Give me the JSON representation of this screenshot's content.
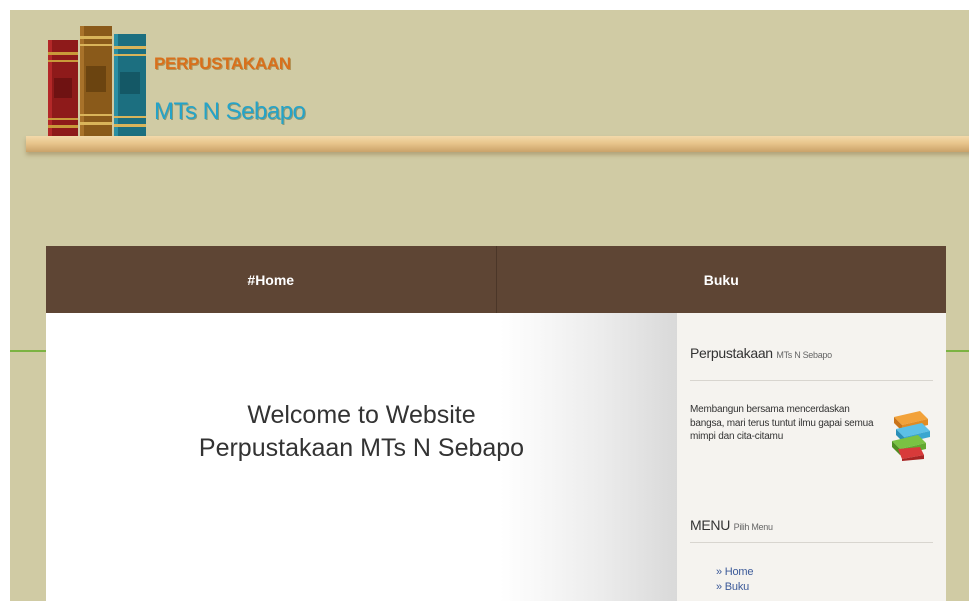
{
  "header": {
    "title": "PERPUSTAKAAN",
    "subtitle": "MTs N Sebapo",
    "logo_icon": "books-icon"
  },
  "nav": {
    "items": [
      {
        "label": "#Home"
      },
      {
        "label": "Buku"
      }
    ]
  },
  "main": {
    "welcome_line1": "Welcome to Website",
    "welcome_line2": "Perpustakaan MTs N Sebapo"
  },
  "sidebar": {
    "widget1": {
      "title": "Perpustakaan",
      "subtitle": "MTs N Sebapo",
      "text": "Membangun bersama mencerdaskan bangsa, mari terus tuntut ilmu gapai semua mimpi dan cita-citamu",
      "icon": "books-stack-icon"
    },
    "widget2": {
      "title": "MENU",
      "subtitle": "Pilih Menu",
      "items": [
        {
          "label": "» Home"
        },
        {
          "label": "» Buku"
        }
      ]
    }
  },
  "colors": {
    "page_background": "#d0cba4",
    "nav_background": "#5e4534",
    "title_orange": "#d8701c",
    "subtitle_blue": "#25a3c8",
    "accent_green": "#7cb342",
    "link_blue": "#3c5a99"
  }
}
